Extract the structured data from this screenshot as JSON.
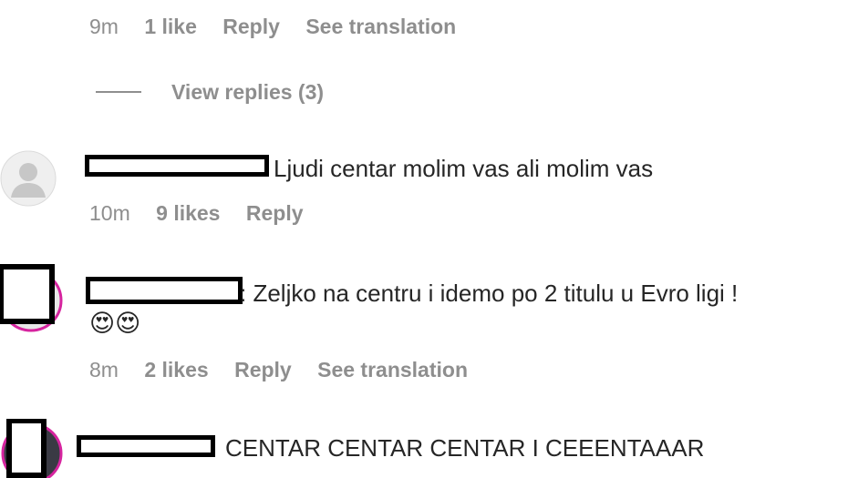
{
  "top_comment": {
    "time": "9m",
    "likes": "1 like",
    "reply": "Reply",
    "translation": "See translation",
    "view_replies": "View replies (3)"
  },
  "comments": [
    {
      "text": "Ljudi centar molim vas ali molim vas",
      "time": "10m",
      "likes": "9 likes",
      "reply": "Reply"
    },
    {
      "text": ": Zeljko na centru i idemo po 2 titulu u Evro ligi !",
      "emoji": "😍😍",
      "time": "8m",
      "likes": "2 likes",
      "reply": "Reply",
      "translation": "See translation"
    },
    {
      "text": "CENTAR CENTAR CENTAR I CEEENTAAAR"
    }
  ],
  "colors": {
    "meta": "#8e8e8e",
    "text": "#262626",
    "story_ring": "#d6249f"
  }
}
